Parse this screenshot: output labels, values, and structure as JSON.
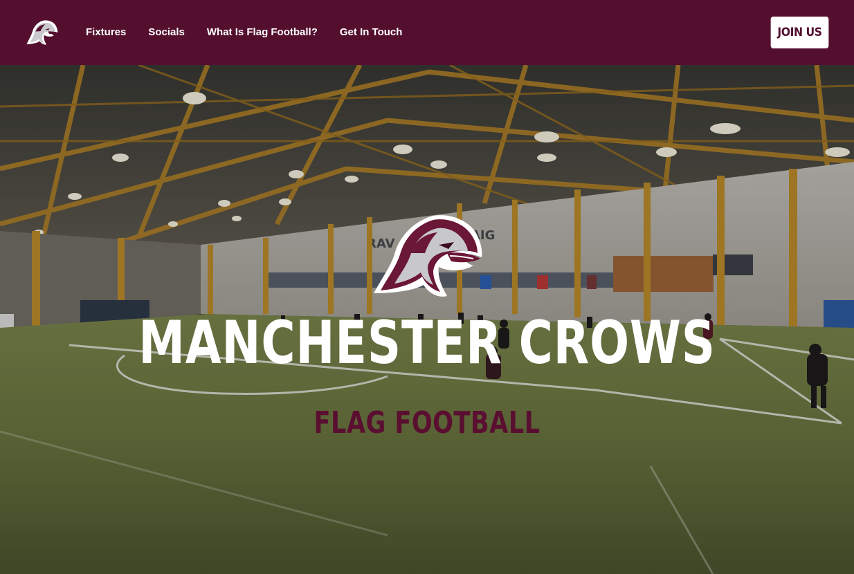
{
  "brand": {
    "primary_color": "#540f2f",
    "logo_icon": "crow-head-icon"
  },
  "nav": {
    "links": [
      {
        "label": "Fixtures"
      },
      {
        "label": "Socials"
      },
      {
        "label": "What Is Flag Football?"
      },
      {
        "label": "Get In Touch"
      }
    ],
    "cta_label": "JOIN US"
  },
  "hero": {
    "title": "MANCHESTER CROWS",
    "subtitle": "FLAG FOOTBALL",
    "crest_icon": "crow-head-icon",
    "background": "indoor-flag-football-pitch-photo"
  }
}
